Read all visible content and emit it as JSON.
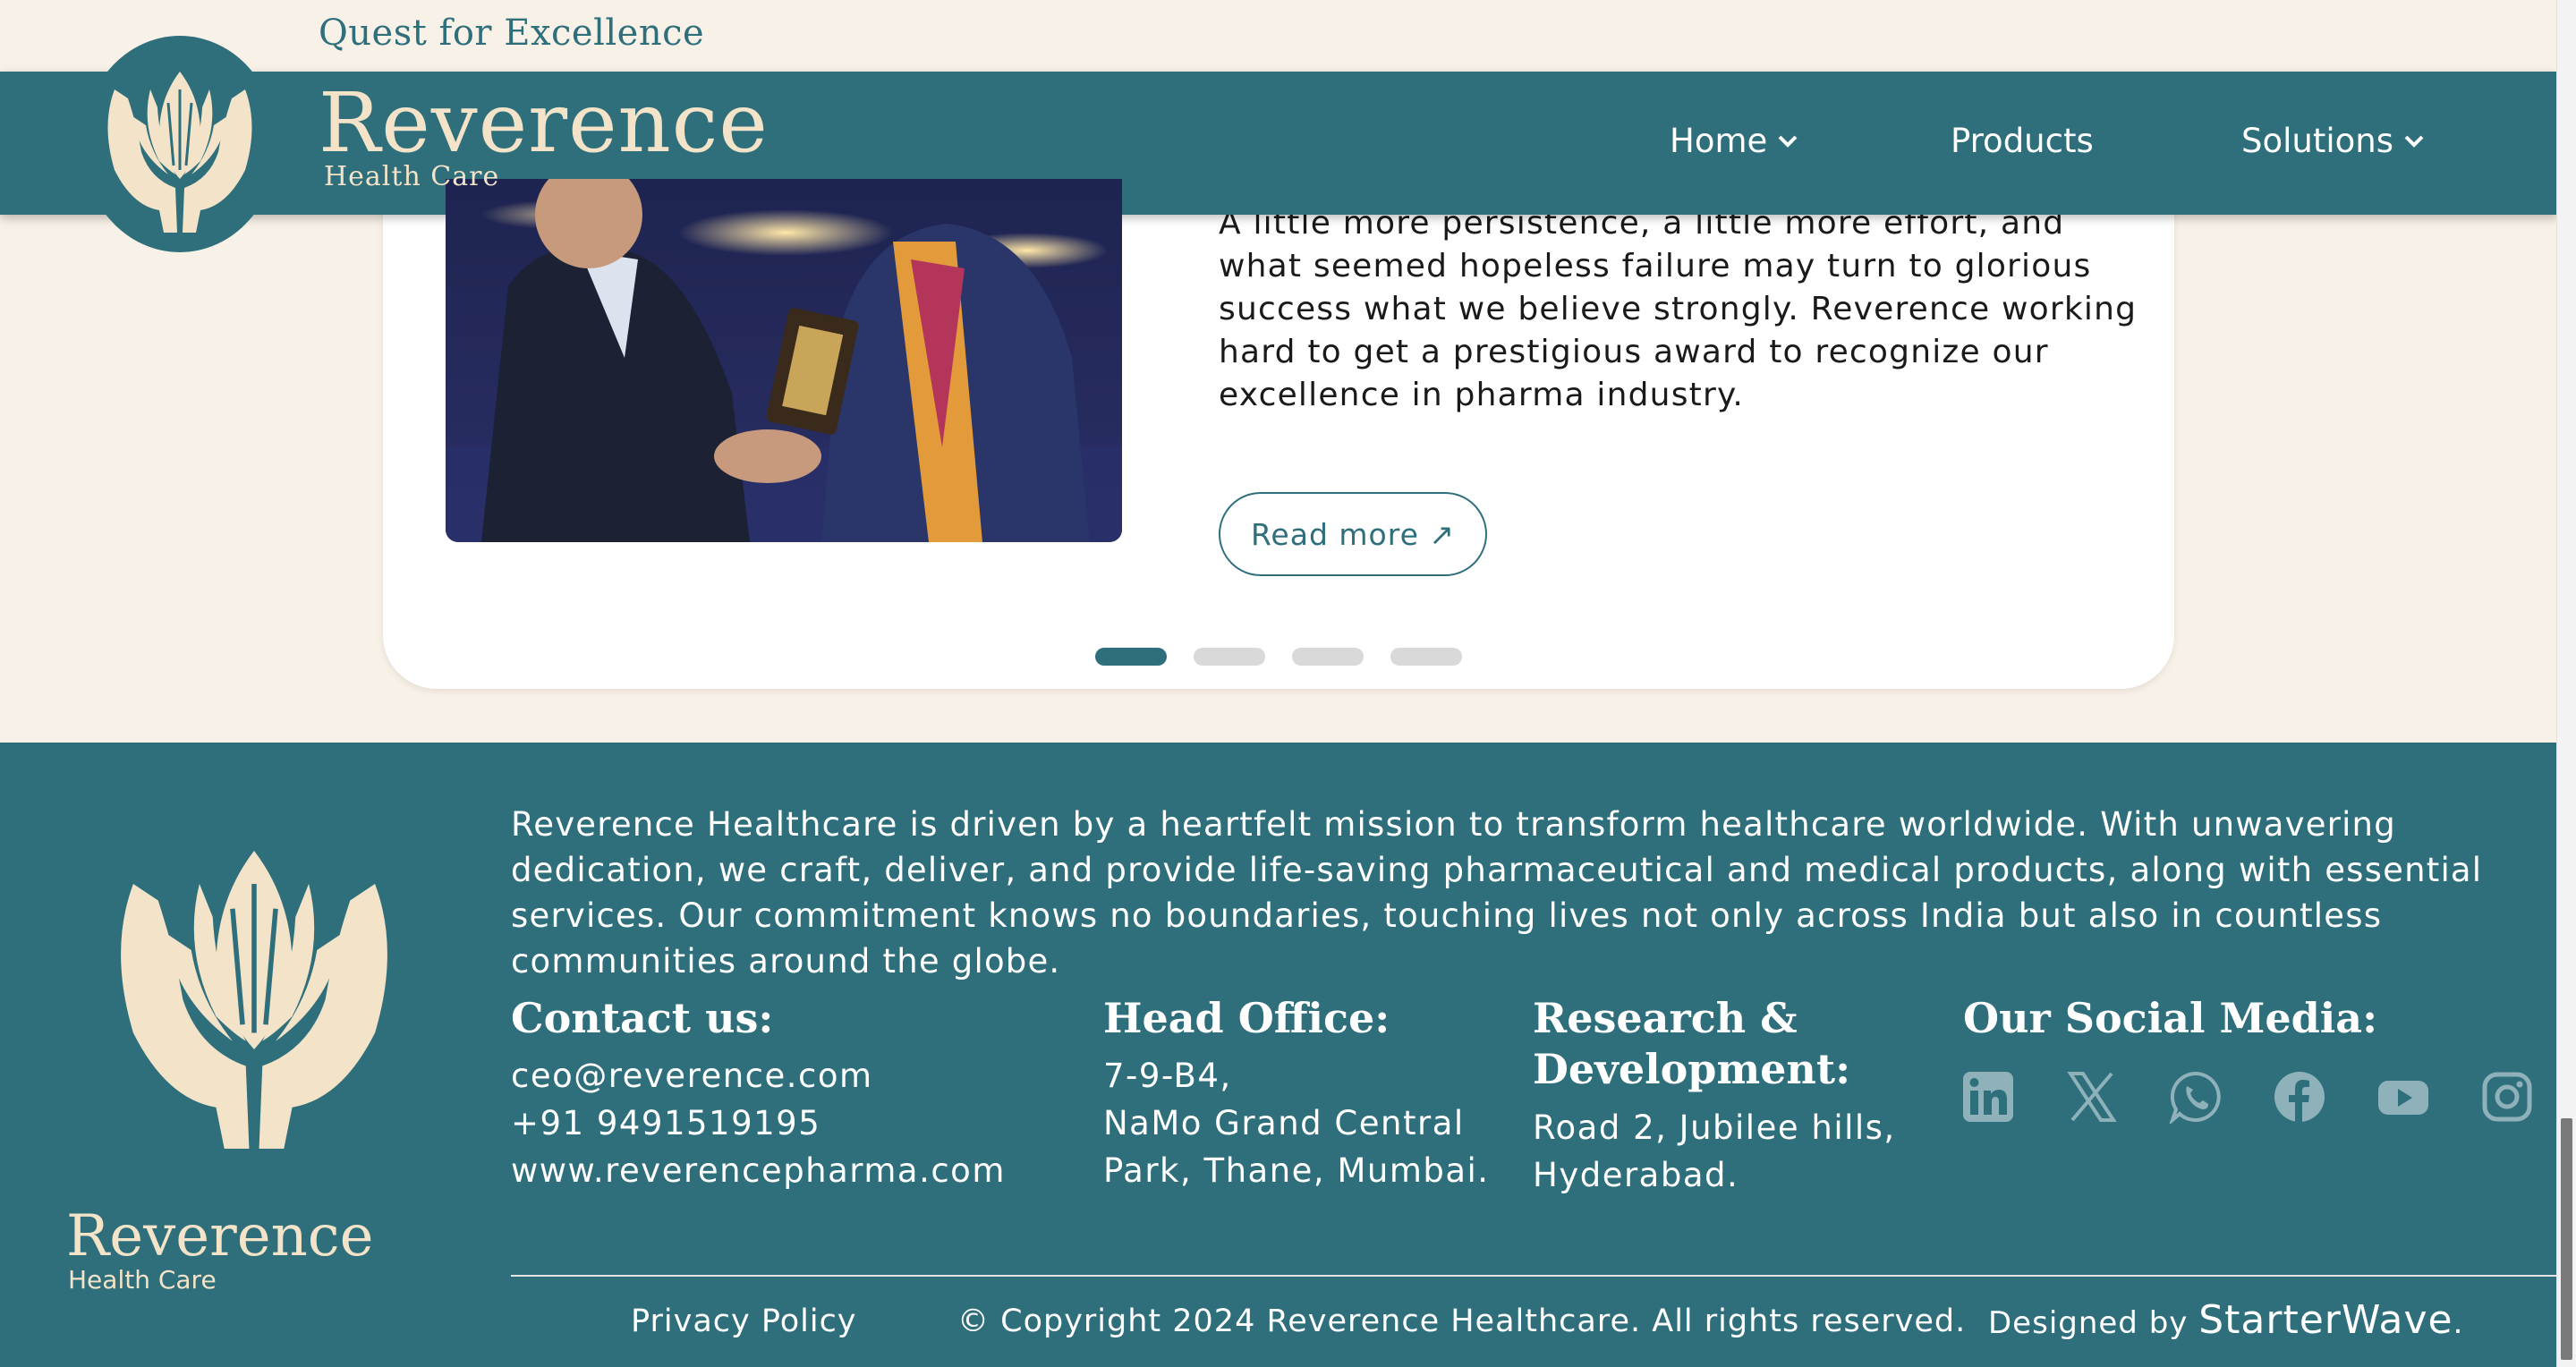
{
  "top": {
    "tagline": "Quest for Excellence"
  },
  "header": {
    "brand": "Reverence",
    "brand_sub": "Health Care",
    "nav": [
      {
        "label": "Home",
        "has_dropdown": true
      },
      {
        "label": "Products",
        "has_dropdown": false
      },
      {
        "label": "Solutions",
        "has_dropdown": true
      }
    ]
  },
  "carousel": {
    "text": "A little more persistence, a little more effort, and what seemed hopeless failure may turn to glorious success what we believe strongly. Reverence working hard to get a prestigious award to recognize our excellence in pharma industry.",
    "read_more": "Read more ↗",
    "slides_count": 4,
    "active_slide": 1
  },
  "footer": {
    "brand": "Reverence",
    "brand_sub": "Health Care",
    "mission": "Reverence Healthcare is driven by a heartfelt mission to transform healthcare worldwide. With unwavering dedication, we craft, deliver, and provide life-saving pharmaceutical and medical products, along with essential services. Our commitment knows no boundaries, touching lives not only across India but also in countless communities around the globe.",
    "contact": {
      "title": "Contact us:",
      "lines": [
        "ceo@reverence.com",
        "+91 9491519195",
        "www.reverencepharma.com"
      ]
    },
    "head_office": {
      "title": "Head Office:",
      "lines": [
        "7-9-B4,",
        "NaMo Grand Central",
        "Park, Thane, Mumbai."
      ]
    },
    "rnd": {
      "title_1": "Research &",
      "title_2": "Development:",
      "lines": [
        "Road 2, Jubilee hills,",
        "Hyderabad."
      ]
    },
    "social": {
      "title": "Our Social Media:",
      "icons": [
        "linkedin-icon",
        "x-icon",
        "whatsapp-icon",
        "facebook-icon",
        "youtube-icon",
        "instagram-icon"
      ]
    },
    "privacy": "Privacy Policy",
    "copyright": "© Copyright 2024 Reverence Healthcare. All rights reserved.",
    "designed_prefix": "Designed by",
    "designer": "StarterWave",
    "designer_suffix": "."
  },
  "colors": {
    "teal": "#2f6f7c",
    "cream": "#f8f1e7",
    "logo_cream": "#f3e3c8",
    "dot_inactive": "#d9d9d9"
  }
}
